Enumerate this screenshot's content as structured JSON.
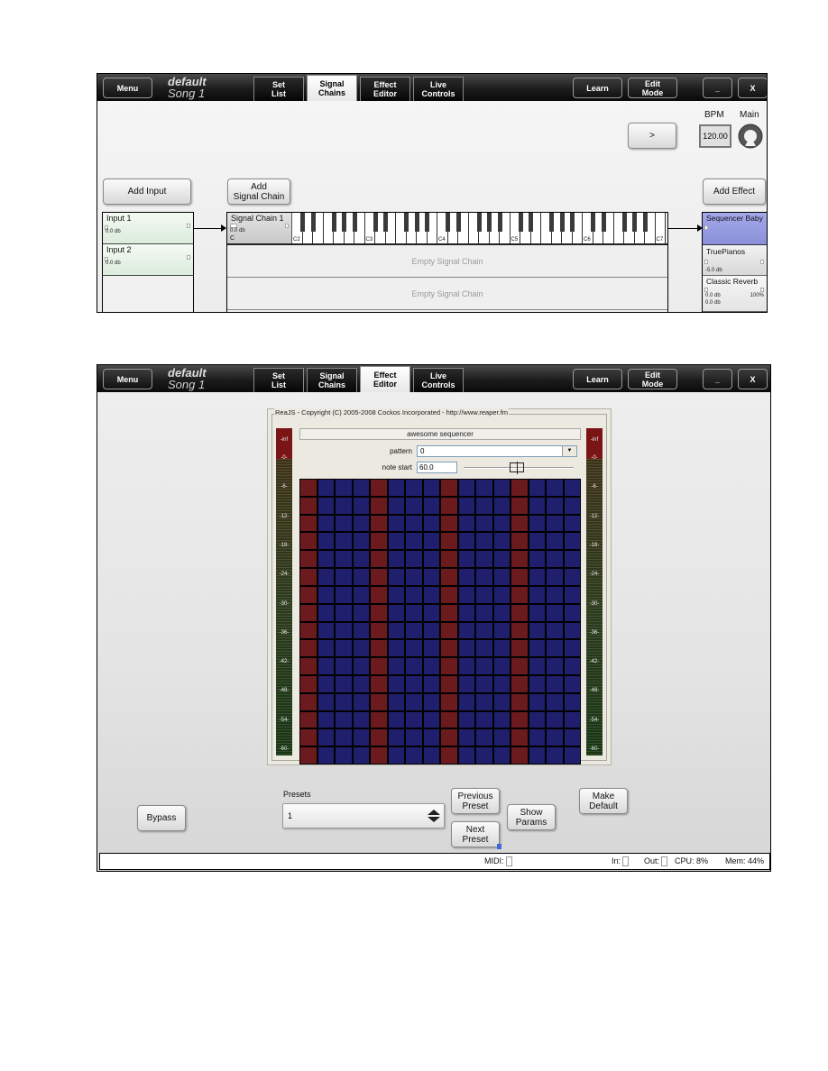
{
  "header": {
    "menu_label": "Menu",
    "song_set": "default",
    "song_name": "Song 1",
    "tabs": [
      {
        "l1": "Set",
        "l2": "List"
      },
      {
        "l1": "Signal",
        "l2": "Chains"
      },
      {
        "l1": "Effect",
        "l2": "Editor"
      },
      {
        "l1": "Live",
        "l2": "Controls"
      }
    ],
    "learn_label": "Learn",
    "edit_mode_l1": "Edit",
    "edit_mode_l2": "Mode",
    "minimize_label": "_",
    "close_label": "X"
  },
  "signal_chains_view": {
    "active_tab": "Signal Chains",
    "play_label": ">",
    "bpm_label": "BPM",
    "bpm_value": "120.00",
    "main_label": "Main",
    "add_input_label": "Add Input",
    "add_chain_l1": "Add",
    "add_chain_l2": "Signal Chain",
    "add_effect_label": "Add Effect",
    "inputs": [
      {
        "name": "Input 1",
        "db": "0.0 db"
      },
      {
        "name": "Input 2",
        "db": "0.0 db"
      }
    ],
    "chain": {
      "name": "Signal Chain 1",
      "db": "0.0 db",
      "key": "C",
      "keyboard_labels": [
        "C2",
        "C3",
        "C4",
        "C5",
        "C6",
        "C7"
      ]
    },
    "empty_chains": [
      "Empty Signal Chain",
      "Empty Signal Chain"
    ],
    "effects": [
      {
        "name": "Sequencer Baby",
        "db": "",
        "extra": "",
        "db2": "",
        "selected": true
      },
      {
        "name": "TruePianos",
        "db": "-5.0 db",
        "extra": "",
        "db2": "",
        "selected": false
      },
      {
        "name": "Classic Reverb",
        "db": "0.0 db",
        "extra": "100%",
        "db2": "0.0 db",
        "selected": false
      }
    ]
  },
  "effect_editor_view": {
    "active_tab": "Effect Editor",
    "plugin": {
      "title": "ReaJS - Copyright (C) 2005-2008 Cockos Incorporated - http://www.reaper.fm",
      "effect_name": "awesome sequencer",
      "pattern_label": "pattern",
      "pattern_value": "0",
      "note_start_label": "note start",
      "note_start_value": "60.0",
      "note_start_slider_fraction": 0.48,
      "meter_labels": [
        "-inf",
        "-0-",
        "-6-",
        "-12-",
        "-18-",
        "-24-",
        "-30-",
        "-36-",
        "-42-",
        "-48-",
        "-54-",
        "-60-"
      ],
      "grid": {
        "rows": 16,
        "columns": 16,
        "highlighted_columns": [
          1,
          5,
          9,
          13
        ],
        "highlight_color": "#6b1a1e",
        "cell_color": "#1f1f6e"
      }
    },
    "bypass_label": "Bypass",
    "presets_label": "Presets",
    "preset_value": "1",
    "previous_preset_l1": "Previous",
    "previous_preset_l2": "Preset",
    "next_preset_l1": "Next",
    "next_preset_l2": "Preset",
    "show_params_l1": "Show",
    "show_params_l2": "Params",
    "make_default_l1": "Make",
    "make_default_l2": "Default",
    "status": {
      "midi_label": "MIDI:",
      "in_label": "In:",
      "out_label": "Out:",
      "cpu": "CPU: 8%",
      "mem": "Mem: 44%"
    }
  },
  "colors": {
    "selected_effect": "#8f95de",
    "input_green": "#dcebdc"
  }
}
